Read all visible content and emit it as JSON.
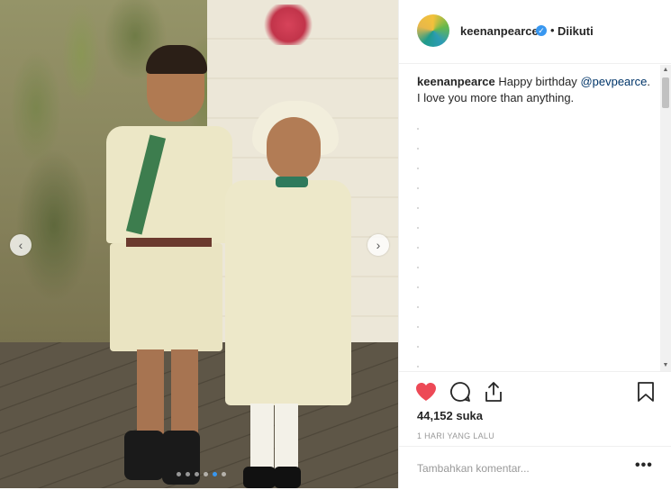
{
  "post": {
    "username": "keenanpearce",
    "verified": true,
    "follow_separator": "•",
    "follow_status": "Diikuti",
    "caption_user": "keenanpearce",
    "caption_text_1": "Happy birthday",
    "caption_mention": "@pevpearce",
    "caption_text_2": ". I love you more than anything.",
    "likes": "44,152 suka",
    "timestamp": "1 HARI YANG LALU",
    "comment_placeholder": "Tambahkan komentar...",
    "more_label": "•••",
    "liked": true,
    "carousel": {
      "total_slides": 6,
      "active_slide": 5
    }
  },
  "icons": {
    "prev": "chevron-left-icon",
    "next": "chevron-right-icon",
    "like": "heart-icon",
    "comment": "comment-bubble-icon",
    "share": "share-icon",
    "save": "bookmark-icon"
  },
  "colors": {
    "like_red": "#ed4956",
    "link_blue": "#003569",
    "verified_blue": "#3897f0",
    "active_dot": "#3897f0"
  }
}
